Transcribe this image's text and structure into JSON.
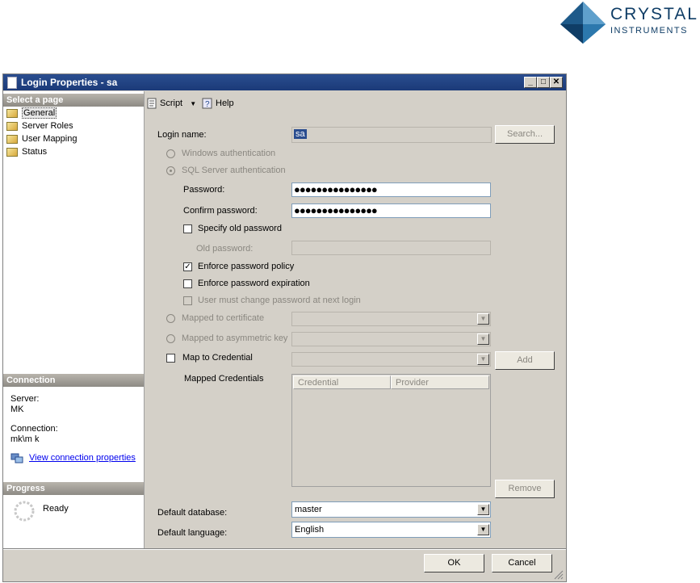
{
  "logo": {
    "line1": "CRYSTAL",
    "line2": "INSTRUMENTS"
  },
  "window": {
    "title": "Login Properties - sa",
    "min": "_",
    "max": "□",
    "close": "✕"
  },
  "left": {
    "select_page_header": "Select a page",
    "pages": [
      "General",
      "Server Roles",
      "User Mapping",
      "Status"
    ],
    "connection_header": "Connection",
    "server_label": "Server:",
    "server_value": "MK",
    "connection_label": "Connection:",
    "connection_value": "mk\\m k",
    "view_connection_link": "View connection properties",
    "progress_header": "Progress",
    "progress_status": "Ready"
  },
  "toolbar": {
    "script_label": "Script",
    "help_label": "Help"
  },
  "form": {
    "login_name_label": "Login name:",
    "login_name_value": "sa",
    "search_button": "Search...",
    "windows_auth": "Windows authentication",
    "sql_auth": "SQL Server authentication",
    "password_label": "Password:",
    "password_value": "●●●●●●●●●●●●●●●",
    "confirm_label": "Confirm password:",
    "confirm_value": "●●●●●●●●●●●●●●●",
    "specify_old": "Specify old password",
    "old_password_label": "Old password:",
    "enforce_policy": "Enforce password policy",
    "enforce_expiration": "Enforce password expiration",
    "must_change": "User must change password at next login",
    "mapped_cert": "Mapped to certificate",
    "mapped_asym": "Mapped to asymmetric key",
    "map_credential": "Map to Credential",
    "add_button": "Add",
    "mapped_credentials": "Mapped Credentials",
    "col_credential": "Credential",
    "col_provider": "Provider",
    "remove_button": "Remove",
    "default_db_label": "Default database:",
    "default_db_value": "master",
    "default_lang_label": "Default language:",
    "default_lang_value": "English",
    "enforce_policy_checked": true
  },
  "footer": {
    "ok": "OK",
    "cancel": "Cancel"
  },
  "colors": {
    "title_bar": "#1b3a78",
    "dialog_bg": "#d4d0c8",
    "link": "#0000ee",
    "logo": "#0f3d66"
  }
}
